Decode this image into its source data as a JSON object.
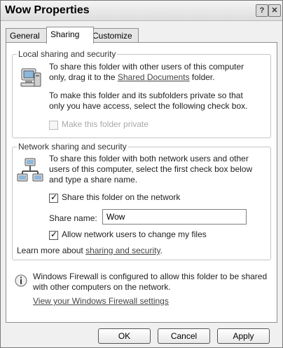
{
  "window": {
    "title": "Wow Properties",
    "help_glyph": "?",
    "close_glyph": "✕"
  },
  "tabs": [
    {
      "label": "General"
    },
    {
      "label": "Sharing"
    },
    {
      "label": "Customize"
    }
  ],
  "local": {
    "legend": "Local sharing and security",
    "line1": "To share this folder with other users of this computer",
    "line2_pre": "only, drag it to the ",
    "line2_link": "Shared Documents",
    "line2_post": " folder.",
    "private_line1": "To make this folder and its subfolders private so that",
    "private_line2": "only you have access, select the following check box.",
    "private_checkbox_label": "Make this folder private",
    "private_checked": false
  },
  "network": {
    "legend": "Network sharing and security",
    "line1": "To share this folder with both network users and other",
    "line2": "users of this computer, select the first check box below",
    "line3": "and type a share name.",
    "share_checkbox_label": "Share this folder on the network",
    "share_checked": true,
    "share_name_label": "Share name:",
    "share_name_value": "Wow",
    "allow_checkbox_label": "Allow network users to change my files",
    "allow_checked": true,
    "learn_more_pre": "Learn more about ",
    "learn_more_link": "sharing and security",
    "learn_more_post": "."
  },
  "firewall": {
    "line1": "Windows Firewall is configured to allow this folder to be shared",
    "line2": "with other computers on the network.",
    "link": "View your Windows Firewall settings"
  },
  "buttons": {
    "ok": "OK",
    "cancel": "Cancel",
    "apply": "Apply"
  }
}
